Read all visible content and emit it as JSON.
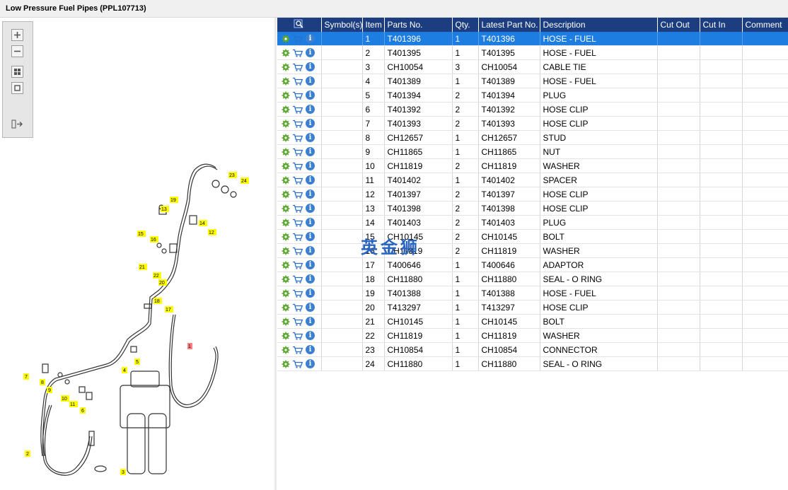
{
  "window": {
    "title": "Low Pressure Fuel Pipes (PPL107713)"
  },
  "toolbar": {
    "buttons": [
      "zoom-in",
      "zoom-out",
      "fit-page",
      "actual-size",
      "export"
    ]
  },
  "diagram": {
    "callouts": [
      "1",
      "2",
      "3",
      "4",
      "5",
      "6",
      "7",
      "8",
      "9",
      "10",
      "11",
      "12",
      "13",
      "14",
      "15",
      "16",
      "17",
      "18",
      "19",
      "20",
      "21",
      "22",
      "23",
      "24"
    ]
  },
  "table": {
    "headers": [
      "",
      "Symbol(s)",
      "Item",
      "Parts No.",
      "Qty.",
      "Latest Part No.",
      "Description",
      "Cut Out",
      "Cut In",
      "Comment"
    ],
    "rows": [
      {
        "item": "1",
        "part": "T401396",
        "qty": "1",
        "latest": "T401396",
        "desc": "HOSE - FUEL",
        "selected": true
      },
      {
        "item": "2",
        "part": "T401395",
        "qty": "1",
        "latest": "T401395",
        "desc": "HOSE - FUEL"
      },
      {
        "item": "3",
        "part": "CH10054",
        "qty": "3",
        "latest": "CH10054",
        "desc": "CABLE TIE"
      },
      {
        "item": "4",
        "part": "T401389",
        "qty": "1",
        "latest": "T401389",
        "desc": "HOSE - FUEL"
      },
      {
        "item": "5",
        "part": "T401394",
        "qty": "2",
        "latest": "T401394",
        "desc": "PLUG"
      },
      {
        "item": "6",
        "part": "T401392",
        "qty": "2",
        "latest": "T401392",
        "desc": "HOSE CLIP"
      },
      {
        "item": "7",
        "part": "T401393",
        "qty": "2",
        "latest": "T401393",
        "desc": "HOSE CLIP"
      },
      {
        "item": "8",
        "part": "CH12657",
        "qty": "1",
        "latest": "CH12657",
        "desc": "STUD"
      },
      {
        "item": "9",
        "part": "CH11865",
        "qty": "1",
        "latest": "CH11865",
        "desc": "NUT"
      },
      {
        "item": "10",
        "part": "CH11819",
        "qty": "2",
        "latest": "CH11819",
        "desc": "WASHER"
      },
      {
        "item": "11",
        "part": "T401402",
        "qty": "1",
        "latest": "T401402",
        "desc": "SPACER"
      },
      {
        "item": "12",
        "part": "T401397",
        "qty": "2",
        "latest": "T401397",
        "desc": "HOSE CLIP"
      },
      {
        "item": "13",
        "part": "T401398",
        "qty": "2",
        "latest": "T401398",
        "desc": "HOSE CLIP"
      },
      {
        "item": "14",
        "part": "T401403",
        "qty": "2",
        "latest": "T401403",
        "desc": "PLUG"
      },
      {
        "item": "15",
        "part": "CH10145",
        "qty": "2",
        "latest": "CH10145",
        "desc": "BOLT"
      },
      {
        "item": "16",
        "part": "CH11819",
        "qty": "2",
        "latest": "CH11819",
        "desc": "WASHER"
      },
      {
        "item": "17",
        "part": "T400646",
        "qty": "1",
        "latest": "T400646",
        "desc": "ADAPTOR"
      },
      {
        "item": "18",
        "part": "CH11880",
        "qty": "1",
        "latest": "CH11880",
        "desc": "SEAL - O RING"
      },
      {
        "item": "19",
        "part": "T401388",
        "qty": "1",
        "latest": "T401388",
        "desc": "HOSE - FUEL"
      },
      {
        "item": "20",
        "part": "T413297",
        "qty": "1",
        "latest": "T413297",
        "desc": "HOSE CLIP"
      },
      {
        "item": "21",
        "part": "CH10145",
        "qty": "1",
        "latest": "CH10145",
        "desc": "BOLT"
      },
      {
        "item": "22",
        "part": "CH11819",
        "qty": "1",
        "latest": "CH11819",
        "desc": "WASHER"
      },
      {
        "item": "23",
        "part": "CH10854",
        "qty": "1",
        "latest": "CH10854",
        "desc": "CONNECTOR"
      },
      {
        "item": "24",
        "part": "CH11880",
        "qty": "1",
        "latest": "CH11880",
        "desc": "SEAL - O RING"
      }
    ]
  },
  "watermark": {
    "text": "英金狮"
  },
  "colors": {
    "header_bg": "#1c3e80",
    "selected_row": "#1e7de0",
    "callout_bg": "#ffff00",
    "callout_selected": "#ff8080"
  }
}
